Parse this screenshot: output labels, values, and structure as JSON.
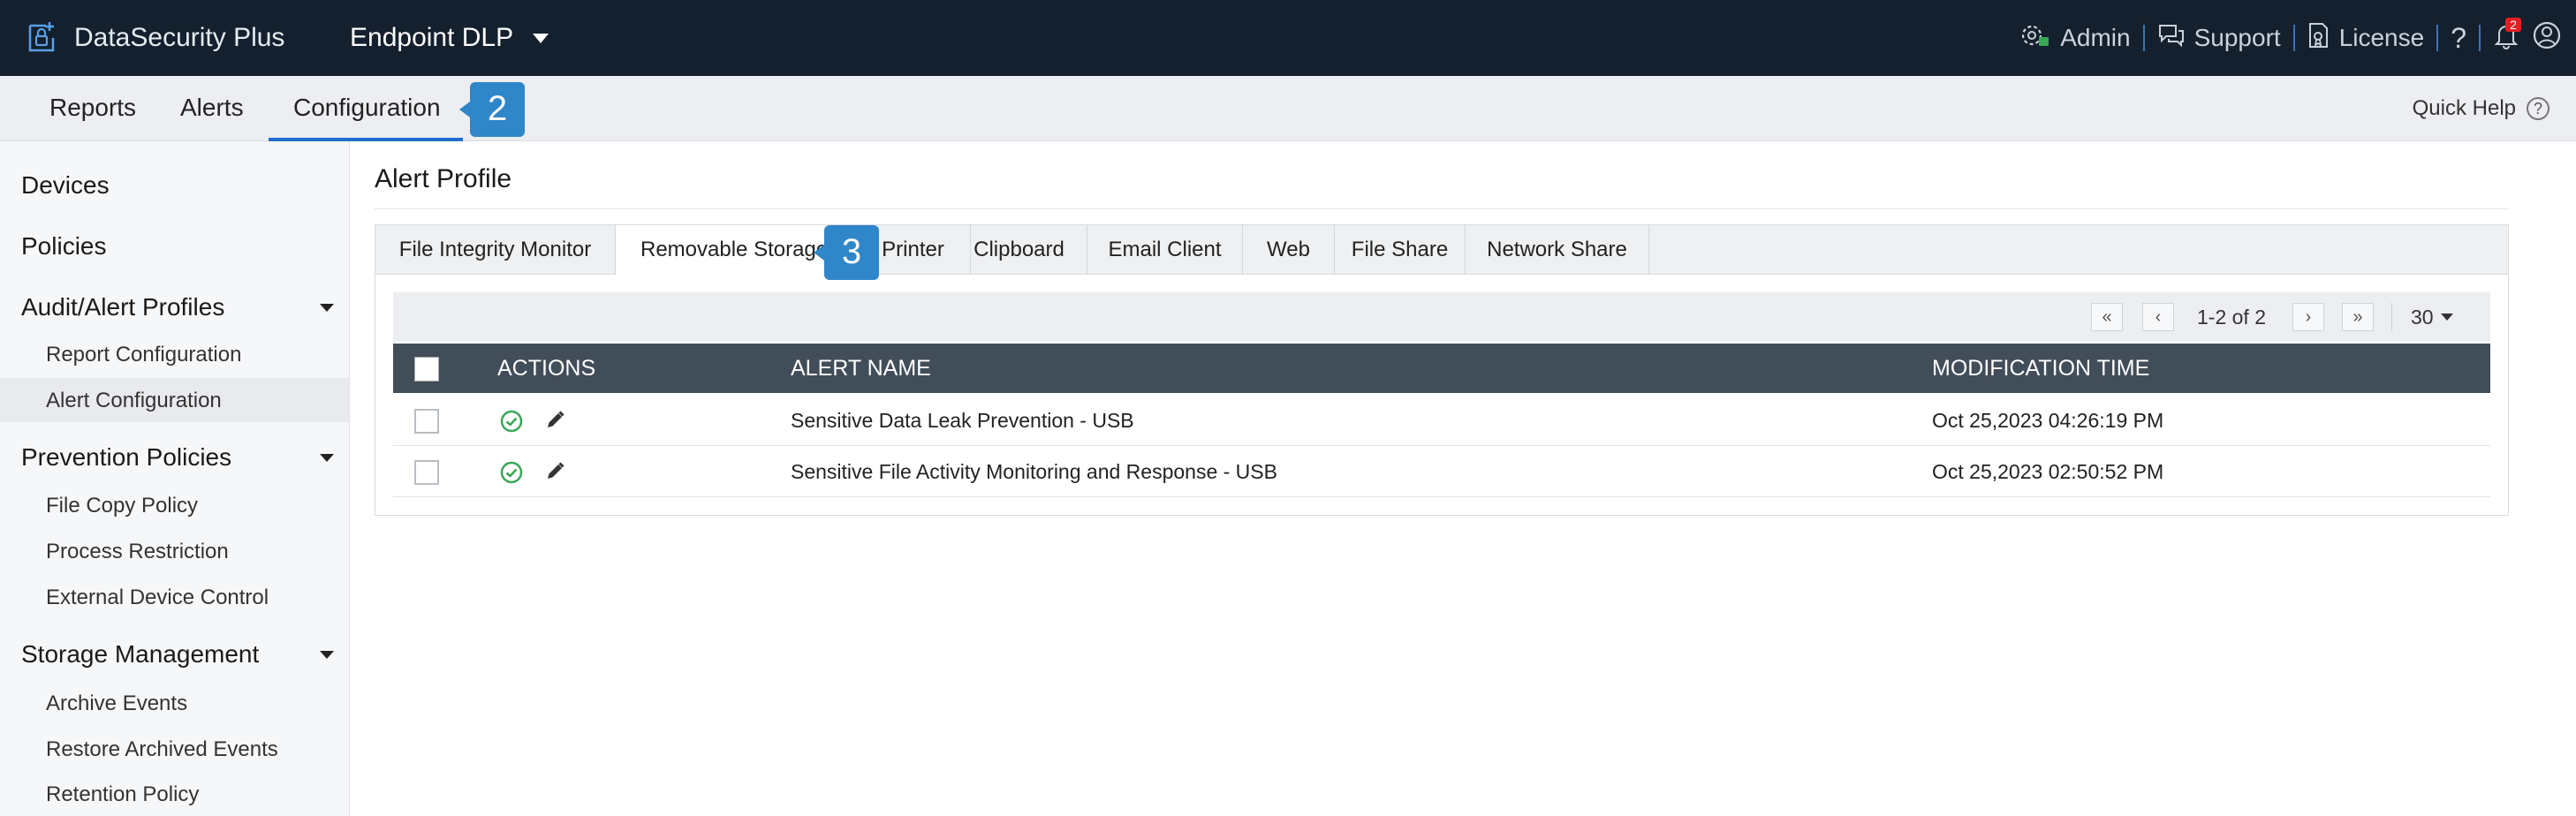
{
  "app": {
    "brand": "DataSecurity Plus",
    "product": "Endpoint DLP"
  },
  "top_links": {
    "admin": "Admin",
    "support": "Support",
    "license": "License",
    "help": "?",
    "notification_count": "2"
  },
  "nav": {
    "tabs": [
      {
        "label": "Reports"
      },
      {
        "label": "Alerts"
      },
      {
        "label": "Configuration",
        "active": true
      }
    ],
    "step_badge": "2",
    "quick_help": "Quick Help"
  },
  "sidebar": {
    "sections": [
      {
        "label": "Devices"
      },
      {
        "label": "Policies"
      },
      {
        "label": "Audit/Alert Profiles",
        "items": [
          "Report Configuration",
          "Alert Configuration"
        ]
      },
      {
        "label": "Prevention Policies",
        "items": [
          "File Copy Policy",
          "Process Restriction",
          "External Device Control"
        ]
      },
      {
        "label": "Storage Management",
        "items": [
          "Archive Events",
          "Restore Archived Events",
          "Retention Policy"
        ]
      }
    ],
    "selected_item": "Alert Configuration"
  },
  "main": {
    "title": "Alert Profile",
    "tabs": [
      {
        "label": "File Integrity Monitor"
      },
      {
        "label": "Removable Storage",
        "active": true
      },
      {
        "label": "Printer"
      },
      {
        "label": "Clipboard"
      },
      {
        "label": "Email Client"
      },
      {
        "label": "Web"
      },
      {
        "label": "File Share"
      },
      {
        "label": "Network Share"
      }
    ],
    "step_badge": "3",
    "pagination": {
      "info": "1-2 of 2",
      "page_size": "30"
    },
    "table": {
      "columns": [
        "ACTIONS",
        "ALERT NAME",
        "MODIFICATION TIME"
      ],
      "rows": [
        {
          "alert_name": "Sensitive Data Leak Prevention - USB",
          "modified": "Oct 25,2023 04:26:19 PM"
        },
        {
          "alert_name": "Sensitive File Activity Monitoring and Response - USB",
          "modified": "Oct 25,2023 02:50:52 PM"
        }
      ]
    }
  },
  "colors": {
    "topbar": "#14202e",
    "accent": "#1e6fd0",
    "badge": "#2f86c8",
    "table_header": "#414d58",
    "success": "#3aa757"
  }
}
